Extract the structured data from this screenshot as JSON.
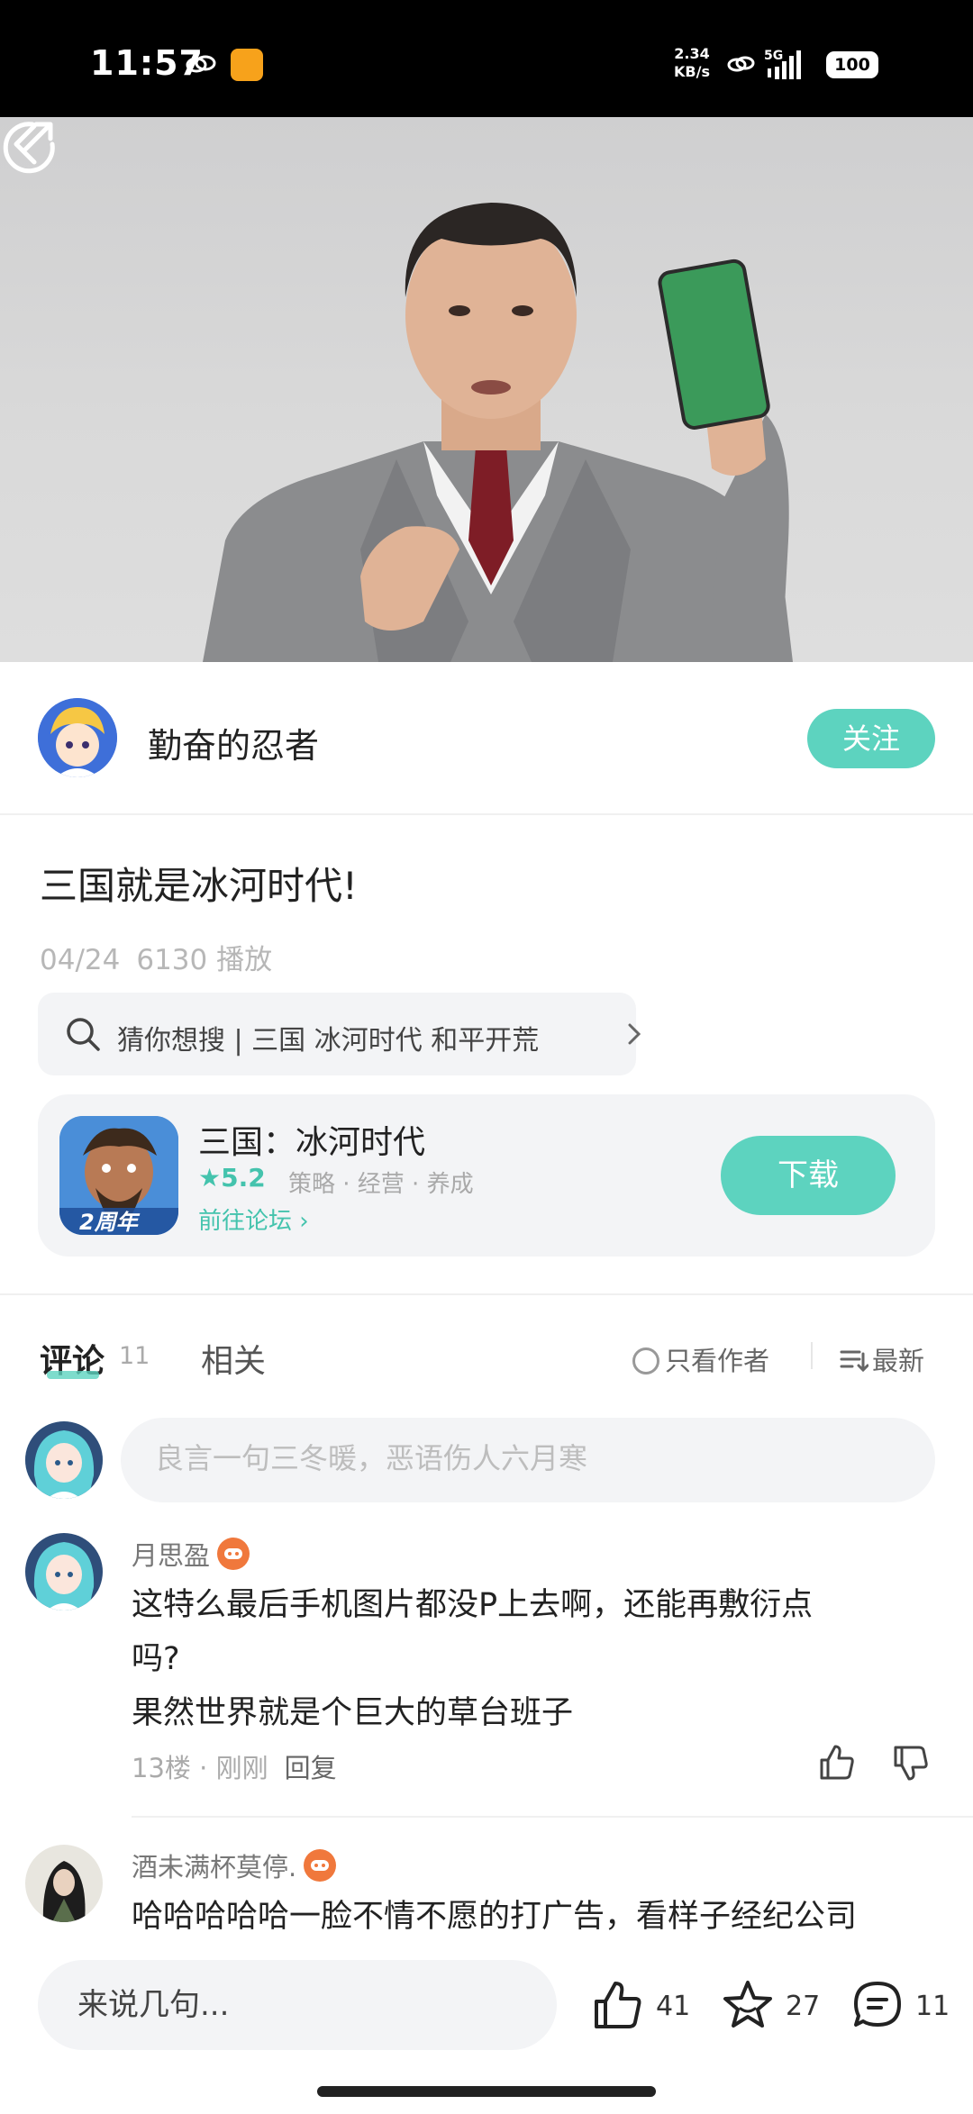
{
  "status_bar": {
    "time": "11:57",
    "speed_value": "2.34",
    "speed_unit": "KB/s",
    "network": "5G",
    "battery": "100"
  },
  "video": {
    "back_icon": "chevron-left-icon",
    "share_icon": "share-icon"
  },
  "author": {
    "name": "勤奋的忍者",
    "follow_label": "关注"
  },
  "post": {
    "title": "三国就是冰河时代!",
    "date": "04/24",
    "plays": "6130 播放"
  },
  "search_chip": {
    "text": "猜你想搜 | 三国 冰河时代 和平开荒"
  },
  "app_card": {
    "name": "三国：冰河时代",
    "rating": "★5.2",
    "tags": "策略 · 经营 · 养成",
    "forum_link": "前往论坛 ›",
    "badge": "2周年",
    "download_label": "下载"
  },
  "tabs": {
    "comments_label": "评论",
    "comments_count": "11",
    "related_label": "相关",
    "only_author_label": "只看作者",
    "sort_label": "最新"
  },
  "comment_input": {
    "placeholder": "良言一句三冬暖，恶语伤人六月寒"
  },
  "comments": [
    {
      "user": "月思盈",
      "lines": [
        "这特么最后手机图片都没P上去啊，还能再敷衍点",
        "吗?",
        "果然世界就是个巨大的草台班子"
      ],
      "floor": "13楼",
      "time": "刚刚",
      "reply_label": "回复"
    },
    {
      "user": "酒未满杯莫停.",
      "lines": [
        "哈哈哈哈哈一脸不情不愿的打广告，看样子经纪公司"
      ]
    }
  ],
  "bottom_bar": {
    "input_label": "来说几句...",
    "likes": "41",
    "favorites": "27",
    "comments": "11"
  },
  "colors": {
    "accent": "#5dd3bf",
    "accent_text": "#44c3ad",
    "badge": "#f0783c"
  }
}
